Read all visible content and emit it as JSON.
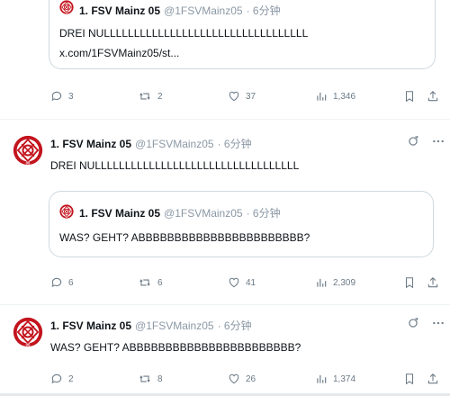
{
  "author": {
    "name": "1. FSV Mainz 05",
    "handle": "@1FSVMainz05",
    "time": "· 6分钟"
  },
  "tweet1": {
    "quote_text": "DREI NULLLLLLLLLLLLLLLLLLLLLLLLLLLLLLLLLL",
    "quote_link": "x.com/1FSVMainz05/st...",
    "replies": "3",
    "reposts": "2",
    "likes": "37",
    "views": "1,346"
  },
  "tweet2": {
    "text": "DREI NULLLLLLLLLLLLLLLLLLLLLLLLLLLLLLLLLL",
    "quote_text": "WAS? GEHT? ABBBBBBBBBBBBBBBBBBBBBBB?",
    "replies": "6",
    "reposts": "6",
    "likes": "41",
    "views": "2,309"
  },
  "tweet3": {
    "text": "WAS? GEHT? ABBBBBBBBBBBBBBBBBBBBBBB?",
    "replies": "2",
    "reposts": "8",
    "likes": "26",
    "views": "1,374"
  },
  "icons": {
    "reply": "reply-icon",
    "repost": "repost-icon",
    "like": "heart-icon",
    "views": "views-icon",
    "bookmark": "bookmark-icon",
    "share": "share-icon",
    "grok": "grok-icon",
    "more": "more-icon"
  },
  "colors": {
    "brand_red": "#c3141e",
    "muted": "#6b7a86",
    "border": "#cfd9de"
  }
}
